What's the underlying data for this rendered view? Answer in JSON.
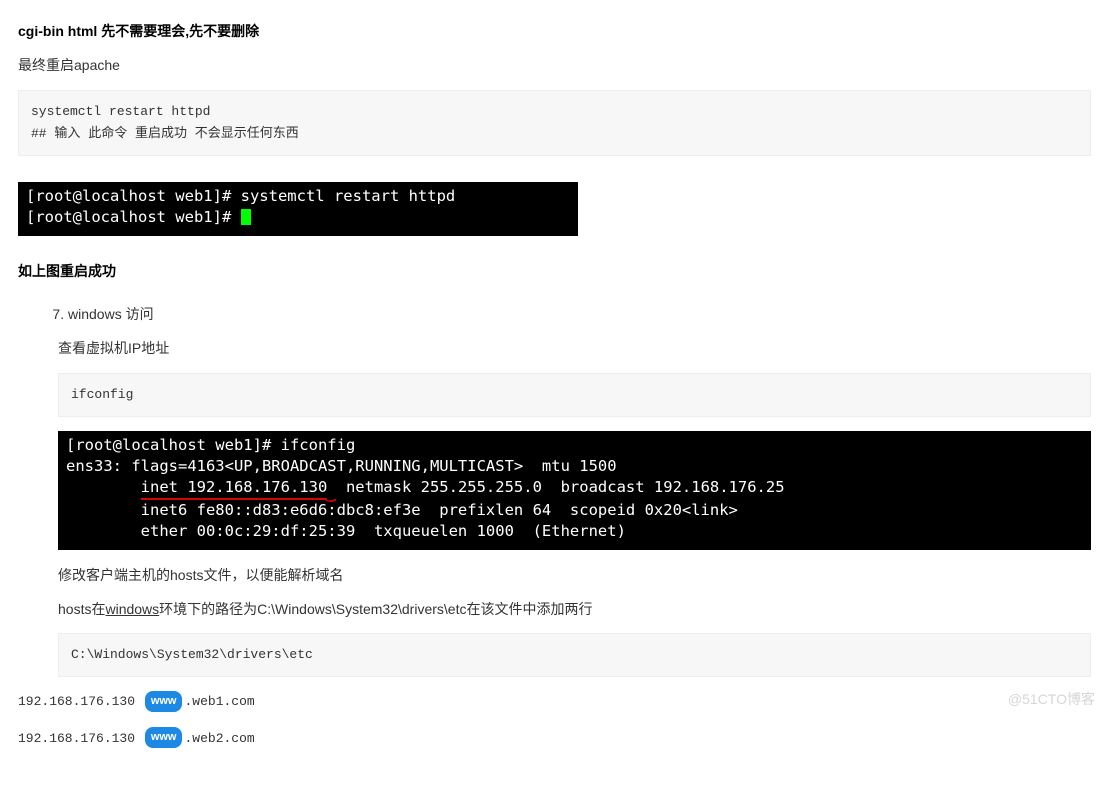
{
  "heading1": "cgi-bin html 先不需要理会,先不要删除",
  "line_restart": "最终重启apache",
  "codeblock1": "systemctl restart httpd\n## 输入 此命令 重启成功 不会显示任何东西",
  "terminal1_l1": "[root@localhost web1]# systemctl restart httpd",
  "terminal1_l2": "[root@localhost web1]# ",
  "heading2": "如上图重启成功",
  "ol_start": "7",
  "ol_item": "windows 访问",
  "ip_lookup": "查看虚拟机IP地址",
  "codeblock2": "ifconfig",
  "terminal2_l1": "[root@localhost web1]# ifconfig",
  "terminal2_l2a": "ens33: flags=4163<UP,BROADCAST,RUNNING,MULTICAST>  mtu 1500",
  "terminal2_inet_label": "        ",
  "terminal2_inet_underlined": "inet 192.168.176.130",
  "terminal2_inet_rest": "  netmask 255.255.255.0  broadcast 192.168.176.25",
  "terminal2_l4": "        inet6 fe80::d83:e6d6:dbc8:ef3e  prefixlen 64  scopeid 0x20<link>",
  "terminal2_l5": "        ether 00:0c:29:df:25:39  txqueuelen 1000  (Ethernet)",
  "hosts_desc": "修改客户端主机的hosts文件，以便能解析域名",
  "hosts_line_prefix": "hosts在",
  "hosts_windows": "windows",
  "hosts_line_suffix": "环境下的路径为C:\\Windows\\System32\\drivers\\etc在该文件中添加两行",
  "codeblock3": "C:\\Windows\\System32\\drivers\\etc",
  "host_ip": "192.168.176.130",
  "www_badge": "www",
  "host1_suffix": ".web1.com",
  "host2_suffix": ".web2.com",
  "watermark": "@51CTO博客"
}
